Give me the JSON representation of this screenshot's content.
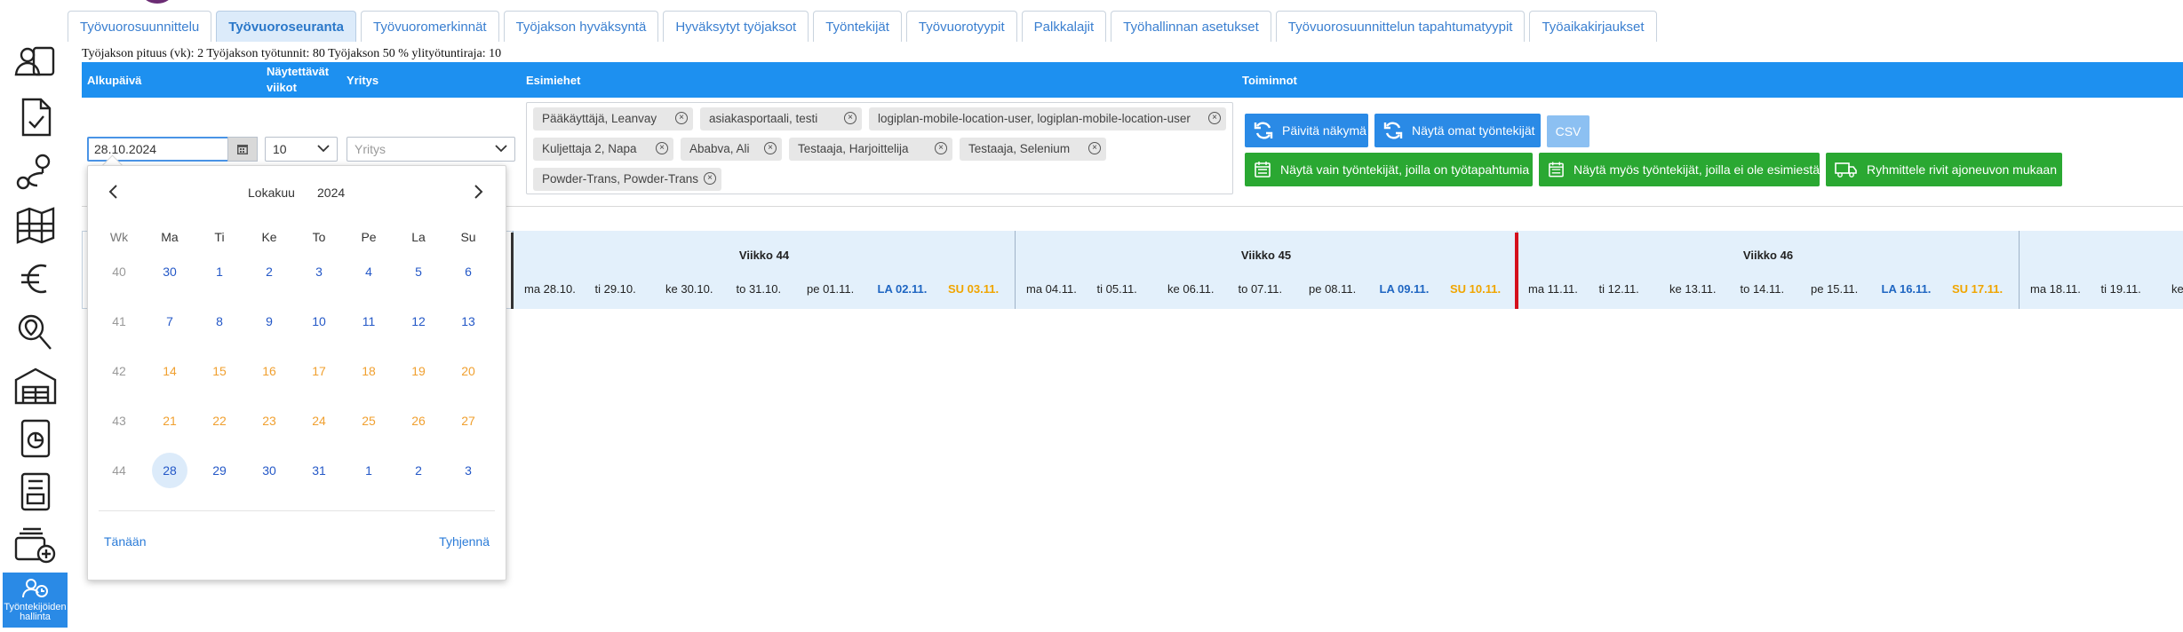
{
  "tabs": [
    {
      "label": "Työvuorosuunnittelu",
      "active": false
    },
    {
      "label": "Työvuoroseuranta",
      "active": true
    },
    {
      "label": "Työvuoromerkinnät",
      "active": false
    },
    {
      "label": "Työjakson hyväksyntä",
      "active": false
    },
    {
      "label": "Hyväksytyt työjaksot",
      "active": false
    },
    {
      "label": "Työntekijät",
      "active": false
    },
    {
      "label": "Työvuorotyypit",
      "active": false
    },
    {
      "label": "Palkkalajit",
      "active": false
    },
    {
      "label": "Työhallinnan asetukset",
      "active": false
    },
    {
      "label": "Työvuorosuunnittelun tapahtumatyypit",
      "active": false
    },
    {
      "label": "Työaikakirjaukset",
      "active": false
    }
  ],
  "sidebar": {
    "icons": [
      "user-card-icon",
      "document-check-icon",
      "route-icon",
      "map-icon",
      "euro-icon",
      "search-map-icon",
      "warehouse-icon",
      "report-icon",
      "form-document-icon",
      "add-stack-icon"
    ],
    "active_label": "Työntekijöiden hallinta"
  },
  "info_line": "Työjakson pituus (vk): 2  Työjakson työtunnit: 80  Työjakson 50 % ylityötuntiraja: 10",
  "filters": {
    "headers": {
      "start_date": "Alkupäivä",
      "weeks": "Näytettävät viikot",
      "company": "Yritys",
      "supervisors": "Esimiehet",
      "actions": "Toiminnot"
    },
    "start_date_value": "28.10.2024",
    "weeks_value": "10",
    "company_placeholder": "Yritys",
    "supervisor_chips": [
      "Pääkäyttäjä, Leanvay",
      "asiakasportaali, testi",
      "logiplan-mobile-location-user, logiplan-mobile-location-user",
      "Kuljettaja 2, Napa",
      "Ababva, Ali",
      "Testaaja, Harjoittelija",
      "Testaaja, Selenium",
      "Powder-Trans, Powder-Trans"
    ]
  },
  "actions": {
    "refresh": "Päivitä näkymä",
    "own_employees": "Näytä omat työntekijät",
    "csv": "CSV",
    "only_with_event": "Näytä vain työntekijät, joilla on työtapahtumia",
    "also_without_supervisor": "Näytä myös työntekijät, joilla ei ole esimiestä",
    "group_by_vehicle": "Ryhmittele rivit ajoneuvon mukaan"
  },
  "weeks": [
    {
      "title": "Viikko 44",
      "days": [
        {
          "label": "ma 28.10.",
          "type": "normal"
        },
        {
          "label": "ti 29.10.",
          "type": "normal"
        },
        {
          "label": "ke 30.10.",
          "type": "normal"
        },
        {
          "label": "to 31.10.",
          "type": "normal"
        },
        {
          "label": "pe 01.11.",
          "type": "normal"
        },
        {
          "label": "LA 02.11.",
          "type": "sat"
        },
        {
          "label": "SU 03.11.",
          "type": "sun"
        }
      ]
    },
    {
      "title": "Viikko 45",
      "days": [
        {
          "label": "ma 04.11.",
          "type": "normal"
        },
        {
          "label": "ti 05.11.",
          "type": "normal"
        },
        {
          "label": "ke 06.11.",
          "type": "normal"
        },
        {
          "label": "to 07.11.",
          "type": "normal"
        },
        {
          "label": "pe 08.11.",
          "type": "normal"
        },
        {
          "label": "LA 09.11.",
          "type": "sat"
        },
        {
          "label": "SU 10.11.",
          "type": "sun"
        }
      ]
    },
    {
      "title": "Viikko 46",
      "days": [
        {
          "label": "ma 11.11.",
          "type": "normal"
        },
        {
          "label": "ti 12.11.",
          "type": "normal"
        },
        {
          "label": "ke 13.11.",
          "type": "normal"
        },
        {
          "label": "to 14.11.",
          "type": "normal"
        },
        {
          "label": "pe 15.11.",
          "type": "normal"
        },
        {
          "label": "LA 16.11.",
          "type": "sat"
        },
        {
          "label": "SU 17.11.",
          "type": "sun"
        }
      ]
    },
    {
      "title": "",
      "days": [
        {
          "label": "ma 18.11.",
          "type": "normal"
        },
        {
          "label": "ti 19.11.",
          "type": "normal"
        },
        {
          "label": "ke",
          "type": "normal"
        }
      ]
    }
  ],
  "datepicker": {
    "month": "Lokakuu",
    "year": "2024",
    "headers": [
      "Wk",
      "Ma",
      "Ti",
      "Ke",
      "To",
      "Pe",
      "La",
      "Su"
    ],
    "rows": [
      {
        "wk": "40",
        "days": [
          {
            "d": "30",
            "s": "normal"
          },
          {
            "d": "1",
            "s": "normal"
          },
          {
            "d": "2",
            "s": "normal"
          },
          {
            "d": "3",
            "s": "normal"
          },
          {
            "d": "4",
            "s": "normal"
          },
          {
            "d": "5",
            "s": "normal"
          },
          {
            "d": "6",
            "s": "normal"
          }
        ]
      },
      {
        "wk": "41",
        "days": [
          {
            "d": "7",
            "s": "normal"
          },
          {
            "d": "8",
            "s": "normal"
          },
          {
            "d": "9",
            "s": "normal"
          },
          {
            "d": "10",
            "s": "normal"
          },
          {
            "d": "11",
            "s": "normal"
          },
          {
            "d": "12",
            "s": "normal"
          },
          {
            "d": "13",
            "s": "normal"
          }
        ]
      },
      {
        "wk": "42",
        "days": [
          {
            "d": "14",
            "s": "orange"
          },
          {
            "d": "15",
            "s": "orange"
          },
          {
            "d": "16",
            "s": "orange"
          },
          {
            "d": "17",
            "s": "orange"
          },
          {
            "d": "18",
            "s": "orange"
          },
          {
            "d": "19",
            "s": "orange"
          },
          {
            "d": "20",
            "s": "orange"
          }
        ]
      },
      {
        "wk": "43",
        "days": [
          {
            "d": "21",
            "s": "orange"
          },
          {
            "d": "22",
            "s": "orange"
          },
          {
            "d": "23",
            "s": "orange"
          },
          {
            "d": "24",
            "s": "orange"
          },
          {
            "d": "25",
            "s": "orange"
          },
          {
            "d": "26",
            "s": "orange"
          },
          {
            "d": "27",
            "s": "orange"
          }
        ]
      },
      {
        "wk": "44",
        "days": [
          {
            "d": "28",
            "s": "selected"
          },
          {
            "d": "29",
            "s": "normal"
          },
          {
            "d": "30",
            "s": "normal"
          },
          {
            "d": "31",
            "s": "normal"
          },
          {
            "d": "1",
            "s": "normal"
          },
          {
            "d": "2",
            "s": "normal"
          },
          {
            "d": "3",
            "s": "normal"
          }
        ]
      }
    ],
    "today_label": "Tänään",
    "clear_label": "Tyhjennä"
  },
  "colors": {
    "primary_blue": "#1d90f0",
    "button_green": "#2aa832",
    "saturday_blue": "#1f66c2",
    "sunday_orange": "#f0a500",
    "today_red": "#d4101c"
  }
}
